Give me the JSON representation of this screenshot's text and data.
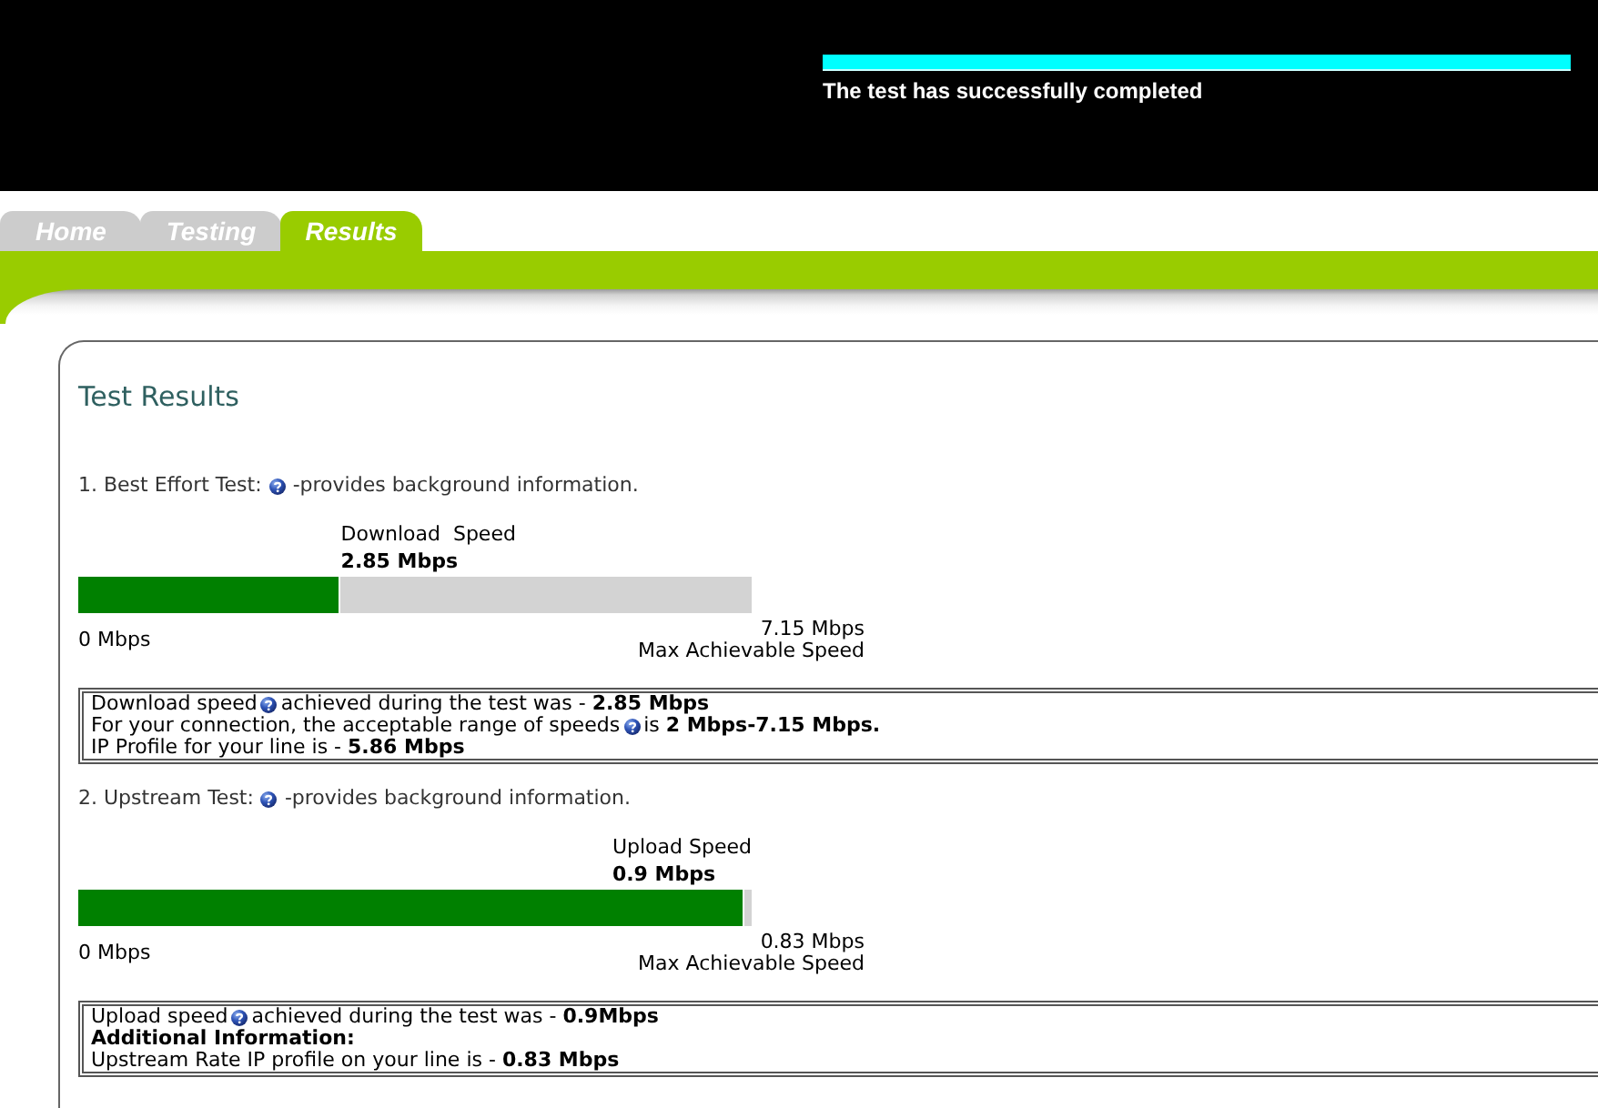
{
  "header": {
    "progress": {
      "level": 1
    },
    "status": "The test has successfully completed"
  },
  "tabs": [
    {
      "label": "Home",
      "selected": false
    },
    {
      "label": "Testing",
      "selected": false
    },
    {
      "label": "Results",
      "selected": true
    }
  ],
  "title": "Test Results",
  "tests": [
    {
      "heading": {
        "title": "1. Best Effort Test:",
        "note": "-provides background information."
      },
      "meter": {
        "label": "Download  Speed",
        "value": "2.85 Mbps",
        "level": 0.39,
        "min": "0 Mbps",
        "max": "7.15 Mbps",
        "max_caption": "Max Achievable Speed"
      },
      "summary": [
        {
          "kind": "text",
          "segments": [
            "Download speed",
            "achieved during the test was - **2.85 Mbps**"
          ]
        },
        {
          "kind": "text",
          "segments": [
            "For your connection, the acceptable range of speeds",
            "is **2 Mbps-7.15 Mbps.**"
          ]
        },
        {
          "kind": "text",
          "segments": [
            "IP Profile for your line is - **5.86 Mbps**"
          ]
        }
      ]
    },
    {
      "heading": {
        "title": "2. Upstream Test:",
        "note": "-provides background information."
      },
      "meter": {
        "label": "Upload Speed",
        "value": "0.9 Mbps",
        "level": 0.99,
        "min": "0 Mbps",
        "max": "0.83 Mbps",
        "max_caption": "Max Achievable Speed"
      },
      "summary": [
        {
          "kind": "text",
          "segments": [
            "Upload speed",
            "achieved during the test was - **0.9Mbps**"
          ]
        },
        {
          "kind": "heading",
          "segments": [
            "Additional Information:"
          ]
        },
        {
          "kind": "text",
          "segments": [
            "Upstream Rate IP profile on your line is - **0.83 Mbps**"
          ]
        }
      ]
    }
  ]
}
